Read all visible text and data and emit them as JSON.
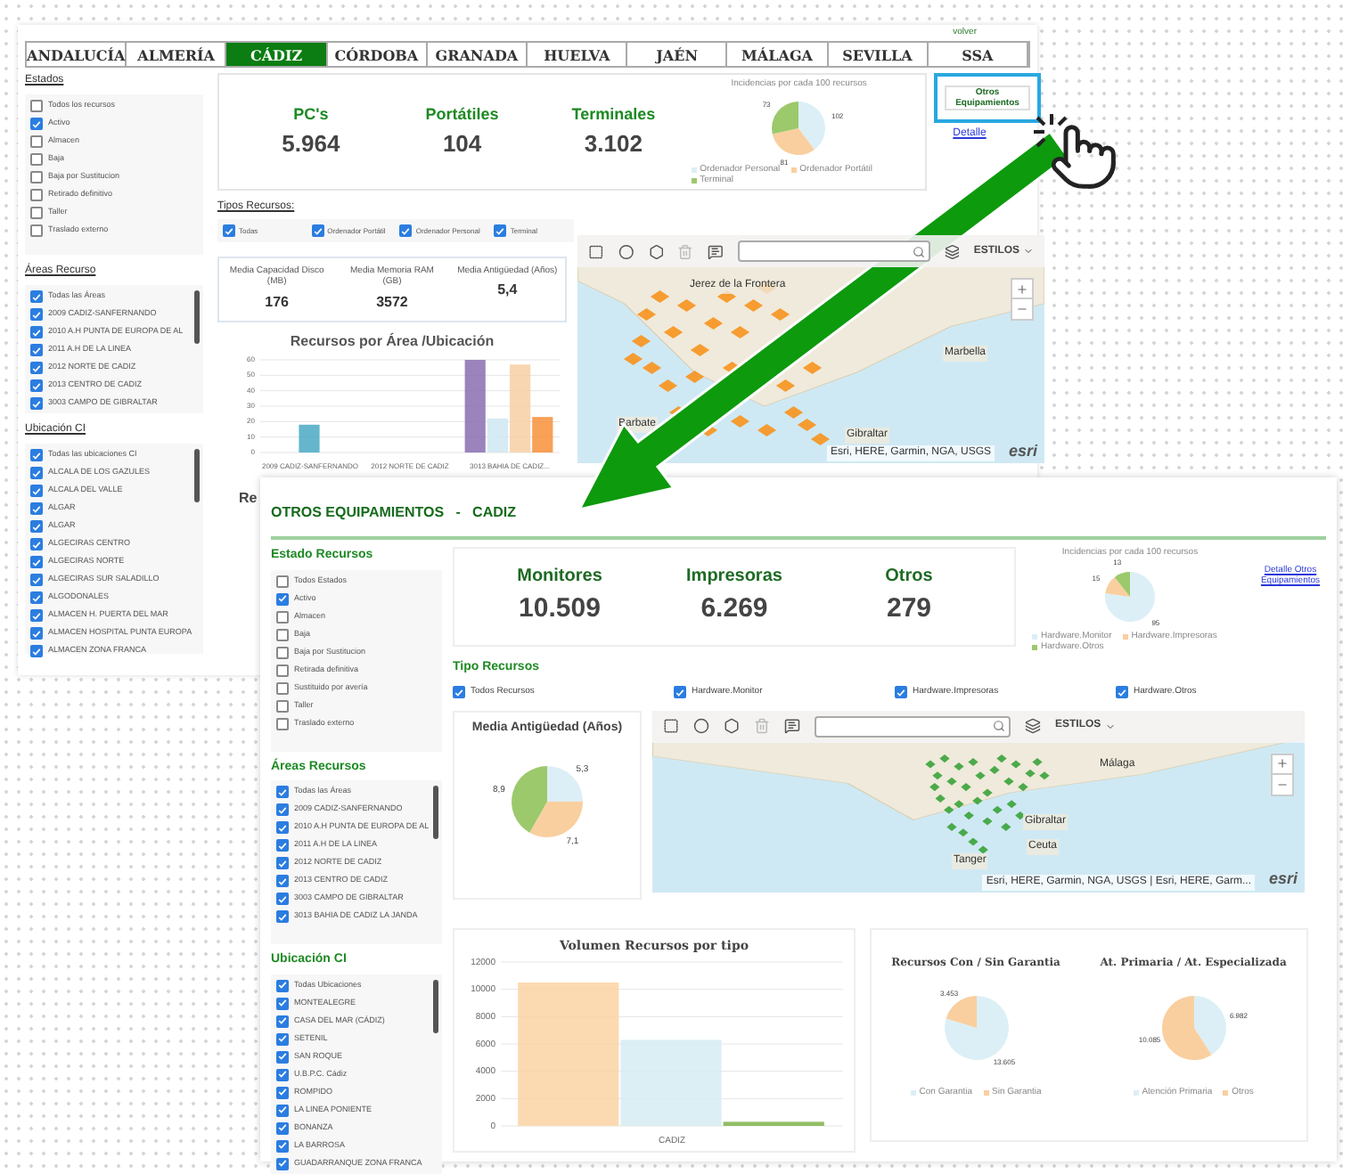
{
  "back_window": {
    "back_link": "volver",
    "tabs": [
      {
        "label": "ANDALUCÍA",
        "selected": false
      },
      {
        "label": "ALMERÍA",
        "selected": false
      },
      {
        "label": "CÁDIZ",
        "selected": true
      },
      {
        "label": "CÓRDOBA",
        "selected": false
      },
      {
        "label": "GRANADA",
        "selected": false
      },
      {
        "label": "HUELVA",
        "selected": false
      },
      {
        "label": "JAÉN",
        "selected": false
      },
      {
        "label": "MÁLAGA",
        "selected": false
      },
      {
        "label": "SEVILLA",
        "selected": false
      },
      {
        "label": "SSA",
        "selected": false
      }
    ],
    "estados": {
      "title": "Estados",
      "items": [
        {
          "label": "Todos los recursos",
          "checked": false
        },
        {
          "label": "Activo",
          "checked": true
        },
        {
          "label": "Almacen",
          "checked": false
        },
        {
          "label": "Baja",
          "checked": false
        },
        {
          "label": "Baja por Sustitucion",
          "checked": false
        },
        {
          "label": "Retirado definitivo",
          "checked": false
        },
        {
          "label": "Taller",
          "checked": false
        },
        {
          "label": "Traslado externo",
          "checked": false
        }
      ]
    },
    "areas": {
      "title": "Áreas Recurso",
      "items": [
        {
          "label": "Todas las Áreas",
          "checked": true
        },
        {
          "label": "2009 CADIZ-SANFERNANDO",
          "checked": true
        },
        {
          "label": "2010 A.H PUNTA DE EUROPA DE AL",
          "checked": true
        },
        {
          "label": "2011 A.H DE LA LINEA",
          "checked": true
        },
        {
          "label": "2012 NORTE DE CADIZ",
          "checked": true
        },
        {
          "label": "2013 CENTRO DE CADIZ",
          "checked": true
        },
        {
          "label": "3003 CAMPO DE GIBRALTAR",
          "checked": true
        }
      ]
    },
    "ubicacion": {
      "title": "Ubicación CI",
      "items": [
        {
          "label": "Todas las ubicaciones CI",
          "checked": true
        },
        {
          "label": "ALCALA DE LOS GAZULES",
          "checked": true
        },
        {
          "label": "ALCALA DEL VALLE",
          "checked": true
        },
        {
          "label": "ALGAR",
          "checked": true
        },
        {
          "label": "ALGAR",
          "checked": true
        },
        {
          "label": "ALGECIRAS CENTRO",
          "checked": true
        },
        {
          "label": "ALGECIRAS NORTE",
          "checked": true
        },
        {
          "label": "ALGECIRAS SUR SALADILLO",
          "checked": true
        },
        {
          "label": "ALGODONALES",
          "checked": true
        },
        {
          "label": "ALMACEN H. PUERTA DEL MAR",
          "checked": true
        },
        {
          "label": "ALMACEN HOSPITAL PUNTA EUROPA",
          "checked": true
        },
        {
          "label": "ALMACEN ZONA FRANCA",
          "checked": true
        }
      ]
    },
    "kpis": [
      {
        "label": "PC's",
        "value": "5.964"
      },
      {
        "label": "Portátiles",
        "value": "104"
      },
      {
        "label": "Terminales",
        "value": "3.102"
      }
    ],
    "incidencias": {
      "title": "Incidencias por cada 100 recursos",
      "chart_data": {
        "type": "pie",
        "categories": [
          "Ordenador Personal",
          "Ordenador Portátil",
          "Terminal"
        ],
        "values": [
          102,
          81,
          73
        ],
        "value_labels": [
          "102",
          "81",
          "73"
        ]
      }
    },
    "otros_button": "Otros Equipamientos",
    "detail_link": "Detalle",
    "tipos": {
      "title": "Tipos Recursos:",
      "items": [
        {
          "label": "Todas",
          "checked": true
        },
        {
          "label": "Ordenador Portátil",
          "checked": true
        },
        {
          "label": "Ordenador Personal",
          "checked": true
        },
        {
          "label": "Terminal",
          "checked": true
        }
      ]
    },
    "stats": [
      {
        "label": "Media Capacidad Disco (MB)",
        "value": "176"
      },
      {
        "label": "Media Memoria RAM (GB)",
        "value": "3572"
      },
      {
        "label": "Media Antigüedad (Años)",
        "value": "5,4"
      }
    ],
    "bar_chart": {
      "chart_data": {
        "type": "bar",
        "title": "Recursos por Área /Ubicación",
        "categories": [
          "2009 CADIZ-SANFERNANDO",
          "2012 NORTE DE CADIZ",
          "3013 BAHIA DE CADIZ..."
        ],
        "yticks": [
          0,
          10,
          20,
          30,
          40,
          50,
          60
        ],
        "ylim": [
          0,
          60
        ],
        "grid": true,
        "series": [
          {
            "color": "#4aa9c4",
            "values": [
              18,
              null,
              null
            ]
          },
          {
            "color": "#8a6fb0",
            "values": [
              null,
              null,
              60
            ]
          },
          {
            "color": "#cfe8f2",
            "values": [
              null,
              null,
              22
            ]
          },
          {
            "color": "#f8cfa4",
            "values": [
              null,
              null,
              57
            ]
          },
          {
            "color": "#f7903a",
            "values": [
              null,
              null,
              23
            ]
          }
        ]
      }
    },
    "map": {
      "styles_label": "ESTILOS",
      "places": [
        "Jerez de la Frontera",
        "Marbella",
        "Barbate",
        "Gibraltar"
      ],
      "attribution": "Esri, HERE, Garmin, NGA, USGS",
      "logo": "esri"
    },
    "next_title": "Re"
  },
  "front_window": {
    "title": "OTROS EQUIPAMIENTOS   -   CADIZ",
    "estados": {
      "title": "Estado Recursos",
      "items": [
        {
          "label": "Todos Estados",
          "checked": false
        },
        {
          "label": "Activo",
          "checked": true
        },
        {
          "label": "Almacen",
          "checked": false
        },
        {
          "label": "Baja",
          "checked": false
        },
        {
          "label": "Baja por Sustitucion",
          "checked": false
        },
        {
          "label": "Retirada definitiva",
          "checked": false
        },
        {
          "label": "Sustituido por avería",
          "checked": false
        },
        {
          "label": "Taller",
          "checked": false
        },
        {
          "label": "Traslado externo",
          "checked": false
        }
      ]
    },
    "areas": {
      "title": "Áreas Recursos",
      "items": [
        {
          "label": "Todas las Áreas",
          "checked": true
        },
        {
          "label": "2009 CADIZ-SANFERNANDO",
          "checked": true
        },
        {
          "label": "2010 A.H PUNTA DE EUROPA DE AL",
          "checked": true
        },
        {
          "label": "2011 A.H DE LA LINEA",
          "checked": true
        },
        {
          "label": "2012 NORTE DE CADIZ",
          "checked": true
        },
        {
          "label": "2013 CENTRO DE CADIZ",
          "checked": true
        },
        {
          "label": "3003 CAMPO DE GIBRALTAR",
          "checked": true
        },
        {
          "label": "3013 BAHIA DE CADIZ LA JANDA",
          "checked": true
        }
      ]
    },
    "ubicacion": {
      "title": "Ubicación CI",
      "items": [
        {
          "label": "Todas Ubicaciones",
          "checked": true
        },
        {
          "label": "MONTEALEGRE",
          "checked": true
        },
        {
          "label": "CASA DEL MAR (CÁDIZ)",
          "checked": true
        },
        {
          "label": "SETENIL",
          "checked": true
        },
        {
          "label": "SAN ROQUE",
          "checked": true
        },
        {
          "label": "U.B.P.C. Cádiz",
          "checked": true
        },
        {
          "label": "ROMPIDO",
          "checked": true
        },
        {
          "label": "LA LINEA PONIENTE",
          "checked": true
        },
        {
          "label": "BONANZA",
          "checked": true
        },
        {
          "label": "LA BARROSA",
          "checked": true
        },
        {
          "label": "GUADARRANQUE ZONA FRANCA",
          "checked": true
        }
      ]
    },
    "kpis": [
      {
        "label": "Monitores",
        "value": "10.509"
      },
      {
        "label": "Impresoras",
        "value": "6.269"
      },
      {
        "label": "Otros",
        "value": "279"
      }
    ],
    "incidencias": {
      "title": "Incidencias por cada 100 recursos",
      "chart_data": {
        "type": "pie",
        "categories": [
          "Hardware.Monitor",
          "Hardware.Impresoras",
          "Hardware.Otros"
        ],
        "values": [
          95,
          15,
          13
        ],
        "value_labels": [
          "95",
          "15",
          "13"
        ]
      }
    },
    "detail_link": "Detalle Otros Equipamientos",
    "tipos": {
      "title": "Tipo Recursos",
      "items": [
        {
          "label": "Todos Recursos",
          "checked": true
        },
        {
          "label": "Hardware.Monitor",
          "checked": true
        },
        {
          "label": "Hardware.Impresoras",
          "checked": true
        },
        {
          "label": "Hardware.Otros",
          "checked": true
        }
      ]
    },
    "age_chart": {
      "chart_data": {
        "type": "pie",
        "title": "Media Antigüedad (Años)",
        "values": [
          5.3,
          7.1,
          8.9
        ],
        "value_labels": [
          "5,3",
          "7,1",
          "8,9"
        ]
      }
    },
    "map": {
      "styles_label": "ESTILOS",
      "places": [
        "Málaga",
        "Gibraltar",
        "Ceuta",
        "Tanger"
      ],
      "attribution": "Esri, HERE, Garmin, NGA, USGS | Esri, HERE, Garm...",
      "logo": "esri"
    },
    "volume_chart": {
      "chart_data": {
        "type": "bar",
        "title": "Volumen Recursos por tipo",
        "categories": [
          "CADIZ"
        ],
        "yticks": [
          0,
          2000,
          4000,
          6000,
          8000,
          10000,
          12000
        ],
        "ylim": [
          0,
          12000
        ],
        "grid": true,
        "series": [
          {
            "color": "#fbd3a3",
            "values": [
              10500
            ]
          },
          {
            "color": "#d6ecf3",
            "values": [
              6300
            ]
          },
          {
            "color": "#7fb24a",
            "values": [
              300
            ]
          }
        ]
      }
    },
    "warranty_chart": {
      "chart_data": {
        "type": "pie",
        "title": "Recursos Con / Sin Garantia",
        "categories": [
          "Con Garantia",
          "Sin Garantia"
        ],
        "values": [
          13605,
          3453
        ],
        "value_labels": [
          "13.605",
          "3.453"
        ]
      }
    },
    "care_chart": {
      "chart_data": {
        "type": "pie",
        "title": "At. Primaria / At. Especializada",
        "categories": [
          "Atención Primaria",
          "Otros"
        ],
        "values": [
          6982,
          10085
        ],
        "value_labels": [
          "6.982",
          "10.085"
        ]
      }
    }
  }
}
